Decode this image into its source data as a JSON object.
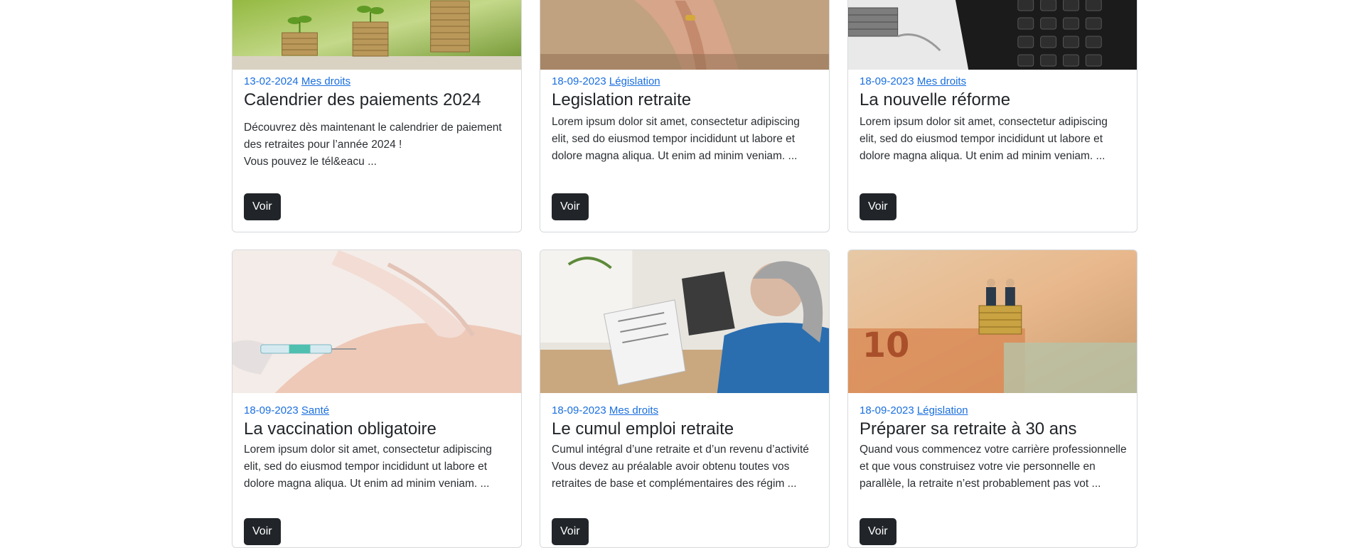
{
  "cards": [
    {
      "date": "13-02-2024",
      "category": "Mes droits",
      "title": "Calendrier des paiements 2024",
      "excerpt": "Découvrez dès maintenant le calendrier de paiement des retraites pour l’année 2024 !\nVous pouvez le tél&eacu ...",
      "button": "Voir",
      "image": "coins-plants-photo"
    },
    {
      "date": "18-09-2023",
      "category": "Législation",
      "title": "Legislation retraite",
      "excerpt": "Lorem ipsum dolor sit amet, consectetur adipiscing elit, sed do eiusmod tempor incididunt ut labore et dolore magna aliqua. Ut enim ad minim veniam. ...",
      "button": "Voir",
      "image": "elderly-hands-photo"
    },
    {
      "date": "18-09-2023",
      "category": "Mes droits",
      "title": "La nouvelle réforme",
      "excerpt": "Lorem ipsum dolor sit amet, consectetur adipiscing elit, sed do eiusmod tempor incididunt ut labore et dolore magna aliqua. Ut enim ad minim veniam. ...",
      "button": "Voir",
      "image": "calculator-coins-photo"
    },
    {
      "date": "18-09-2023",
      "category": "Santé",
      "title": "La vaccination obligatoire",
      "excerpt": "Lorem ipsum dolor sit amet, consectetur adipiscing elit, sed do eiusmod tempor incididunt ut labore et dolore magna aliqua. Ut enim ad minim veniam. ...",
      "button": "Voir",
      "image": "vaccination-syringe-photo"
    },
    {
      "date": "18-09-2023",
      "category": "Mes droits",
      "title": "Le cumul emploi retraite",
      "excerpt": "Cumul intégral d’une retraite et d’un revenu d’activité Vous devez au préalable avoir obtenu toutes vos retraites de base et complémentaires des régim ...",
      "button": "Voir",
      "image": "woman-reading-document-photo"
    },
    {
      "date": "18-09-2023",
      "category": "Législation",
      "title": "Préparer sa retraite à 30 ans",
      "excerpt": "Quand vous commencez votre carrière professionnelle et que vous construisez votre vie personnelle en parallèle, la retraite n’est probablement pas vot ...",
      "button": "Voir",
      "image": "figurines-on-coins-photo"
    }
  ]
}
